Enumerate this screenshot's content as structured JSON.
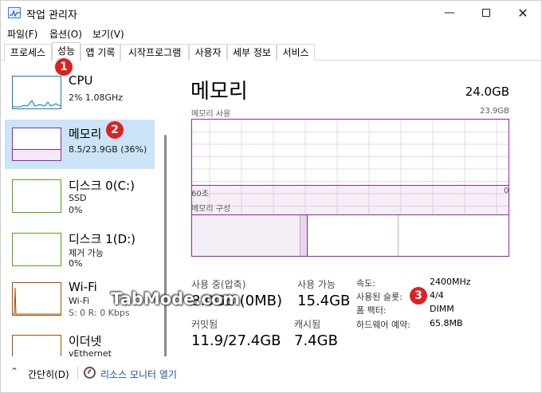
{
  "window": {
    "title": "작업 관리자"
  },
  "menu": [
    "파일(F)",
    "옵션(O)",
    "보기(V)"
  ],
  "tabs": [
    "프로세스",
    "성능",
    "앱 기록",
    "시작프로그램",
    "사용자",
    "세부 정보",
    "서비스"
  ],
  "badges": [
    "1",
    "2",
    "3"
  ],
  "sidebar": {
    "items": [
      {
        "title": "CPU",
        "sub1": "2% 1.08GHz",
        "sub2": ""
      },
      {
        "title": "메모리",
        "sub1": "8.5/23.9GB (36%)",
        "sub2": ""
      },
      {
        "title": "디스크 0(C:)",
        "sub1": "SSD",
        "sub2": "0%"
      },
      {
        "title": "디스크 1(D:)",
        "sub1": "제거 가능",
        "sub2": "0%"
      },
      {
        "title": "Wi-Fi",
        "sub1": "Wi-Fi",
        "sub2": "S: 0 R: 0 Kbps"
      },
      {
        "title": "이더넷",
        "sub1": "vEthernet (Default...",
        "sub2": ""
      }
    ]
  },
  "main": {
    "title": "메모리",
    "total": "24.0GB",
    "usage_label": "메모리 사용",
    "usage_max": "23.9GB",
    "time_left": "60초",
    "time_right": "0",
    "composition_label": "메모리 구성",
    "stats": [
      {
        "label": "사용 중(압축)",
        "value": "8.0GB (0MB)"
      },
      {
        "label": "사용 가능",
        "value": "15.4GB"
      },
      {
        "label": "커밋됨",
        "value": "11.9/27.4GB"
      },
      {
        "label": "캐시됨",
        "value": "7.4GB"
      }
    ],
    "details": [
      {
        "label": "속도:",
        "value": "2400MHz"
      },
      {
        "label": "사용된 슬롯:",
        "value": "4/4"
      },
      {
        "label": "폼 팩터:",
        "value": "DIMM"
      },
      {
        "label": "하드웨어 예약:",
        "value": "65.8MB"
      }
    ]
  },
  "footer": {
    "collapse_label": "간단히(D)",
    "monitor_label": "리소스 모니터 열기"
  },
  "watermark": "TabMode.com",
  "colors": {
    "accent_memory": "#8b2a9b",
    "accent_cpu": "#117dbb",
    "accent_disk": "#4da60c",
    "accent_wifi": "#a74f01",
    "selected": "#cce4f7",
    "badge": "#e02020"
  }
}
